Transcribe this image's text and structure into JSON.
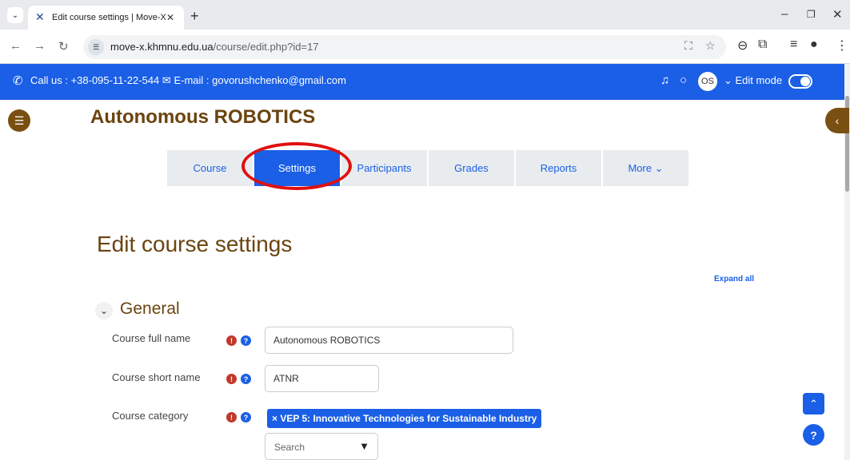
{
  "browser": {
    "tab_title": "Edit course settings | Move-X",
    "url_host": "move-x.khmnu.edu.ua",
    "url_path": "/course/edit.php?id=17"
  },
  "site": {
    "contact_text": "Call us : +38-095-11-22-544",
    "email_text": "E-mail : govorushchenko@gmail.com",
    "user_initials": "OS",
    "edit_mode_label": "Edit mode",
    "edit_mode_on": true,
    "brand_color": "#1a5fe6",
    "accent_color": "#6b4410"
  },
  "course": {
    "title": "Autonomous ROBOTICS"
  },
  "secondary_nav": {
    "items": [
      "Course",
      "Settings",
      "Participants",
      "Grades",
      "Reports",
      "More ⌄"
    ],
    "active": "Settings"
  },
  "page": {
    "heading": "Edit course settings",
    "expand_all": "Expand all"
  },
  "general_section": {
    "title": "General",
    "fields": {
      "fullname_label": "Course full name",
      "fullname_value": "Autonomous ROBOTICS",
      "shortname_label": "Course short name",
      "shortname_value": "ATNR",
      "category_label": "Course category",
      "category_value": "× VEP 5: Innovative Technologies for Sustainable Industry",
      "category_search_placeholder": "Search"
    }
  },
  "icons": {
    "back_to_top": "chevron-up-icon",
    "help": "question-icon"
  }
}
